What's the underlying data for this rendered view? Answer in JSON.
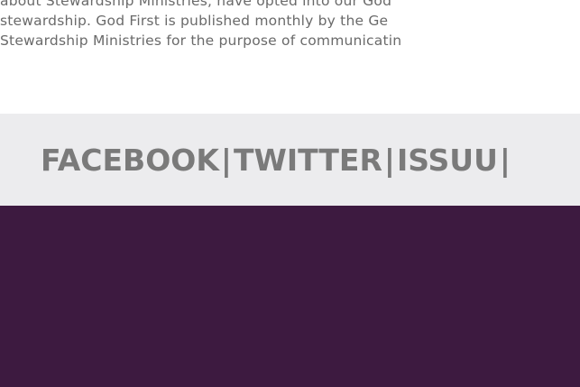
{
  "intro": {
    "line_1": "about Stewardship Ministries, have opted into our God",
    "line_2": "stewardship. God First is published monthly by the Ge",
    "line_3": "Stewardship Ministries for the purpose of communicatin"
  },
  "social": {
    "links": [
      "FACEBOOK",
      "TWITTER",
      "ISSUU"
    ],
    "separator": "|"
  },
  "colors": {
    "intro_text": "#6a6a6a",
    "social_bar_bg": "#ececee",
    "social_text": "#7a7a7a",
    "footer_bg": "#3d1a40"
  }
}
